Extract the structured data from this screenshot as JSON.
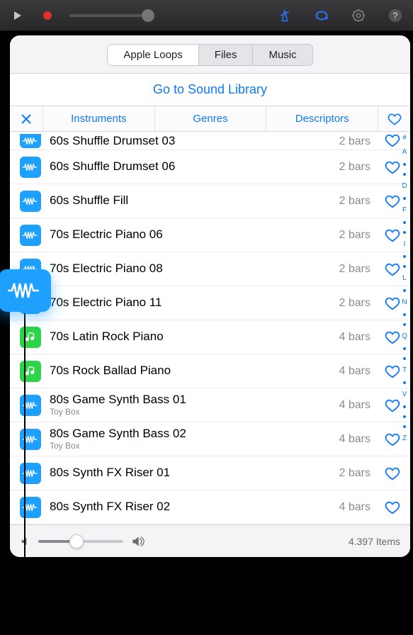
{
  "topbar": {
    "play": "▶",
    "record": "●"
  },
  "segments": [
    "Apple Loops",
    "Files",
    "Music"
  ],
  "library_link": "Go to Sound Library",
  "filters": {
    "instruments": "Instruments",
    "genres": "Genres",
    "descriptors": "Descriptors"
  },
  "rows": [
    {
      "title": "60s Shuffle Drumset 03",
      "bars": "2 bars",
      "type": "blue",
      "partial": true
    },
    {
      "title": "60s Shuffle Drumset 06",
      "bars": "2 bars",
      "type": "blue"
    },
    {
      "title": "60s Shuffle Fill",
      "bars": "2 bars",
      "type": "blue"
    },
    {
      "title": "70s Electric Piano 06",
      "bars": "2 bars",
      "type": "blue"
    },
    {
      "title": "70s Electric Piano 08",
      "bars": "2 bars",
      "type": "blue"
    },
    {
      "title": "70s Electric Piano 11",
      "bars": "2 bars",
      "type": "blue"
    },
    {
      "title": "70s Latin Rock Piano",
      "bars": "4 bars",
      "type": "green"
    },
    {
      "title": "70s Rock Ballad Piano",
      "bars": "4 bars",
      "type": "green"
    },
    {
      "title": "80s Game Synth Bass 01",
      "bars": "4 bars",
      "type": "blue",
      "sub": "Toy Box"
    },
    {
      "title": "80s Game Synth Bass 02",
      "bars": "4 bars",
      "type": "blue",
      "sub": "Toy Box"
    },
    {
      "title": "80s Synth FX Riser 01",
      "bars": "2 bars",
      "type": "blue"
    },
    {
      "title": "80s Synth FX Riser 02",
      "bars": "4 bars",
      "type": "blue"
    }
  ],
  "index": [
    "#",
    "A",
    "·",
    "·",
    "D",
    "·",
    "F",
    "·",
    "·",
    "I",
    "·",
    "·",
    "L",
    "·",
    "N",
    "·",
    "·",
    "Q",
    "·",
    "·",
    "T",
    "·",
    "V",
    "·",
    "·",
    "·",
    "Z"
  ],
  "footer": {
    "count": "4.397 Items"
  }
}
